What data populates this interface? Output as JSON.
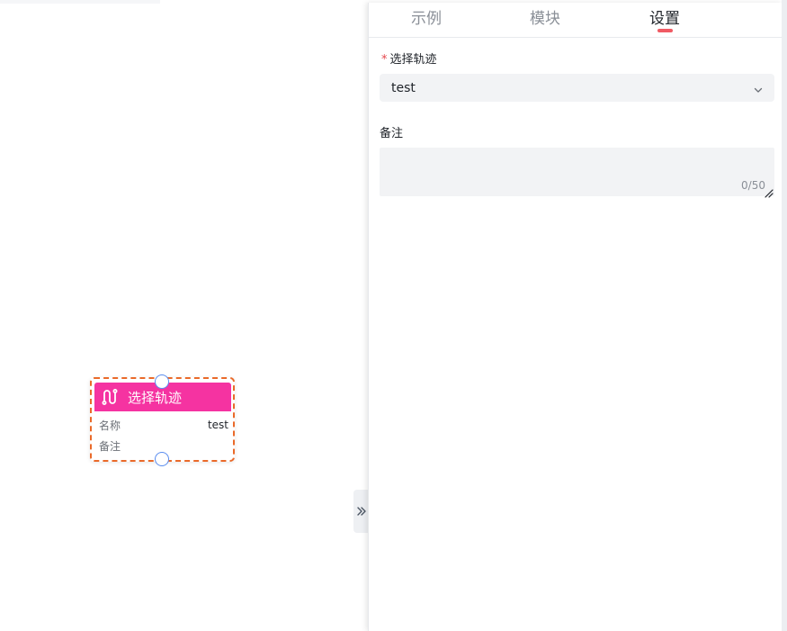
{
  "node": {
    "title": "选择轨迹",
    "rows": [
      {
        "key": "名称",
        "value": "test"
      },
      {
        "key": "备注",
        "value": ""
      }
    ],
    "header_color": "#f533a1",
    "border_color": "#ea6a2a",
    "icon": "route-icon"
  },
  "panel": {
    "tabs": [
      {
        "label": "示例"
      },
      {
        "label": "模块"
      },
      {
        "label": "设置"
      }
    ],
    "active_tab": "设置",
    "fields": {
      "track": {
        "required_mark": "*",
        "label": "选择轨迹",
        "value": "test",
        "icon": "chevron-down-icon"
      },
      "remark": {
        "label": "备注",
        "value": "",
        "counter": "0/50"
      }
    }
  },
  "collapse_handle": {
    "icon": "double-chevron-right-icon"
  },
  "colors": {
    "accent": "#f05a63",
    "required": "#e5484d",
    "port": "#5b8def"
  }
}
